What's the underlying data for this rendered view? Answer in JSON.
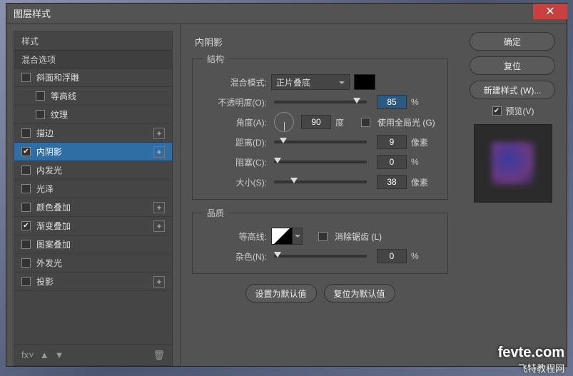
{
  "window": {
    "title": "图层样式"
  },
  "sidebar": {
    "header": "样式",
    "blending": "混合选项",
    "items": [
      {
        "label": "斜面和浮雕",
        "checked": false,
        "plus": false,
        "indent": false
      },
      {
        "label": "等高线",
        "checked": false,
        "plus": false,
        "indent": true
      },
      {
        "label": "纹理",
        "checked": false,
        "plus": false,
        "indent": true
      },
      {
        "label": "描边",
        "checked": false,
        "plus": true,
        "indent": false
      },
      {
        "label": "内阴影",
        "checked": true,
        "plus": true,
        "indent": false,
        "selected": true
      },
      {
        "label": "内发光",
        "checked": false,
        "plus": false,
        "indent": false
      },
      {
        "label": "光泽",
        "checked": false,
        "plus": false,
        "indent": false
      },
      {
        "label": "颜色叠加",
        "checked": false,
        "plus": true,
        "indent": false
      },
      {
        "label": "渐变叠加",
        "checked": true,
        "plus": true,
        "indent": false
      },
      {
        "label": "图案叠加",
        "checked": false,
        "plus": false,
        "indent": false
      },
      {
        "label": "外发光",
        "checked": false,
        "plus": false,
        "indent": false
      },
      {
        "label": "投影",
        "checked": false,
        "plus": true,
        "indent": false
      }
    ]
  },
  "main": {
    "title": "内阴影",
    "structure": {
      "legend": "结构",
      "blend_label": "混合模式:",
      "blend_value": "正片叠底",
      "opacity_label": "不透明度(O):",
      "opacity_value": "85",
      "opacity_unit": "%",
      "angle_label": "角度(A):",
      "angle_value": "90",
      "angle_unit": "度",
      "global_label": "使用全局光 (G)",
      "distance_label": "距离(D):",
      "distance_value": "9",
      "distance_unit": "像素",
      "choke_label": "阻塞(C):",
      "choke_value": "0",
      "choke_unit": "%",
      "size_label": "大小(S):",
      "size_value": "38",
      "size_unit": "像素"
    },
    "quality": {
      "legend": "品质",
      "contour_label": "等高线:",
      "aa_label": "消除锯齿 (L)",
      "noise_label": "杂色(N):",
      "noise_value": "0",
      "noise_unit": "%"
    },
    "defaults_btn": "设置为默认值",
    "reset_btn": "复位为默认值"
  },
  "right": {
    "ok": "确定",
    "cancel": "复位",
    "newstyle": "新建样式 (W)...",
    "preview_label": "预览(V)"
  },
  "watermark": {
    "line1": "fevte.com",
    "line2": "飞特教程网"
  }
}
